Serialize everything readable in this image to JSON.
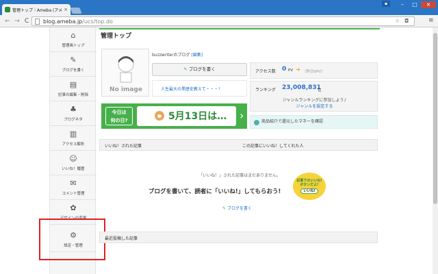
{
  "browser": {
    "tab_title": "管理トップ｜Ameba (アメーバ)",
    "tab_close": "×",
    "window_user": "▪",
    "window_min": "–",
    "window_max": "□",
    "window_close": "×",
    "nav_back": "←",
    "nav_forward": "→",
    "nav_reload": "C",
    "url_host": "blog.ameba.jp",
    "url_path": "/ucs/top.do",
    "star_icon": "☆",
    "camera_icon": "◘",
    "menu_icon": "≡"
  },
  "sidebar": {
    "items": [
      {
        "label": "管理画トップ",
        "icon": "home-icon",
        "glyph": "⌂"
      },
      {
        "label": "ブログを書く",
        "icon": "pen-icon",
        "glyph": "✎"
      },
      {
        "label": "記事の編集・削除",
        "icon": "folder-icon",
        "glyph": "▤"
      },
      {
        "label": "ブログネタ",
        "icon": "sprout-icon",
        "glyph": "♣"
      },
      {
        "label": "アクセス解析",
        "icon": "bar-chart-icon",
        "glyph": "▥"
      },
      {
        "label": "いいね！履歴",
        "icon": "smile-icon",
        "glyph": "☺"
      },
      {
        "label": "コメント管理",
        "icon": "speech-bubble-icon",
        "glyph": "✉"
      },
      {
        "label": "デザインの変更",
        "icon": "palette-icon",
        "glyph": "✿"
      },
      {
        "label": "設定・管理",
        "icon": "gear-icon",
        "glyph": "⚙"
      }
    ]
  },
  "main": {
    "page_title": "管理トップ",
    "avatar_label": "No image",
    "blog_name": "buzzwriterのブログ",
    "edit_link": "[編集]",
    "write_button": "ブログを書く",
    "blog_title_link": "人生最大の黒歴史教えて・・・！",
    "access_label": "アクセス数",
    "access_value": "0",
    "access_unit": "PV",
    "access_prev": "（昨日0PV）",
    "ranking_label": "ランキング",
    "ranking_value": "23,008,831",
    "ranking_unit": "位",
    "genre_text": "ジャンルランキングに参加しよう♪",
    "genre_link": "ジャンルを設定する",
    "promo_text": "商品紹介で還元したマネーを確認",
    "banner": {
      "line1": "今日は",
      "line2": "何の日?",
      "date_text": "5月13日は…",
      "arrow": "›"
    },
    "table": {
      "col_left": "いいね！された記事",
      "col_right": "この記事にいいね！してくれた人"
    },
    "empty_message": "「いいね！」された記事はまだありません。",
    "cta_text": "ブログを書いて、読者に「いいね!」してもらおう!",
    "cta_badge_line1": "記事下のいいね!",
    "cta_badge_line2": "ボタンだよ!",
    "cta_badge_pill": "いいね!",
    "cta_link": "ブログを書く",
    "recent_header": "最近投稿した記事"
  },
  "colors": {
    "titlebar": "#2a75c5",
    "brand_green": "#47b04a",
    "link_blue": "#1a6fc9",
    "highlight_red": "#e02020"
  }
}
